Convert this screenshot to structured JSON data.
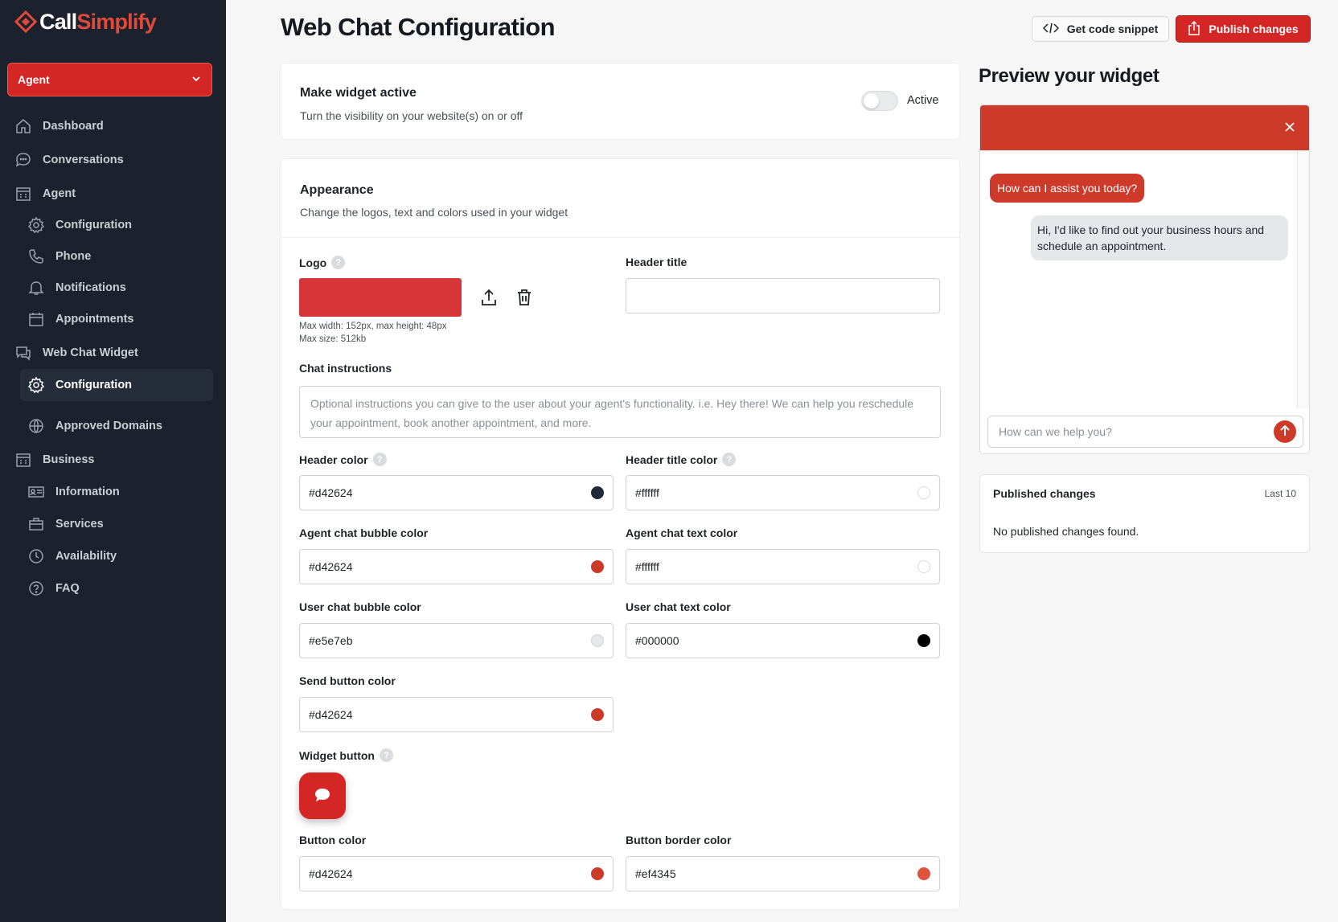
{
  "brand": {
    "name_part1": "Call",
    "name_part2": "Simplify",
    "accent": "#d42624"
  },
  "agent_select": {
    "value": "Agent"
  },
  "sidebar": {
    "dashboard": "Dashboard",
    "conversations": "Conversations",
    "agent": "Agent",
    "agent_configuration": "Configuration",
    "phone": "Phone",
    "notifications": "Notifications",
    "appointments": "Appointments",
    "web_chat_widget": "Web Chat Widget",
    "widget_configuration": "Configuration",
    "approved_domains": "Approved Domains",
    "business": "Business",
    "information": "Information",
    "services": "Services",
    "availability": "Availability",
    "faq": "FAQ"
  },
  "header": {
    "title": "Web Chat Configuration",
    "snippet_button": "Get code snippet",
    "publish_button": "Publish changes"
  },
  "active_card": {
    "title": "Make widget active",
    "subtitle": "Turn the visibility on your website(s) on or off",
    "toggle_label": "Active"
  },
  "appearance": {
    "title": "Appearance",
    "subtitle": "Change the logos, text and colors used in your widget",
    "logo_label": "Logo",
    "logo_hint_1": "Max width: 152px, max height: 48px",
    "logo_hint_2": "Max size: 512kb",
    "header_title_label": "Header title",
    "header_title_value": "",
    "chat_instructions_label": "Chat instructions",
    "chat_instructions_placeholder": "Optional instructions you can give to the user about your agent's functionality. i.e. Hey there! We can help you reschedule your appointment, book another appointment, and more.",
    "header_color_label": "Header color",
    "header_color_value": "#d42624",
    "header_title_color_label": "Header title color",
    "header_title_color_value": "#ffffff",
    "agent_bubble_label": "Agent chat bubble color",
    "agent_bubble_value": "#d42624",
    "agent_text_label": "Agent chat text color",
    "agent_text_value": "#ffffff",
    "user_bubble_label": "User chat bubble color",
    "user_bubble_value": "#e5e7eb",
    "user_text_label": "User chat text color",
    "user_text_value": "#000000",
    "send_button_label": "Send button color",
    "send_button_value": "#d42624",
    "widget_button_label": "Widget button",
    "button_color_label": "Button color",
    "button_color_value": "#d42624",
    "button_border_label": "Button border color",
    "button_border_value": "#ef4345"
  },
  "preview": {
    "title": "Preview your widget",
    "agent_message": "How can I assist you today?",
    "user_message": "Hi, I'd like to find out your business hours and schedule an appointment.",
    "input_placeholder": "How can we help you?"
  },
  "published": {
    "title": "Published changes",
    "meta": "Last 10",
    "empty": "No published changes found."
  }
}
